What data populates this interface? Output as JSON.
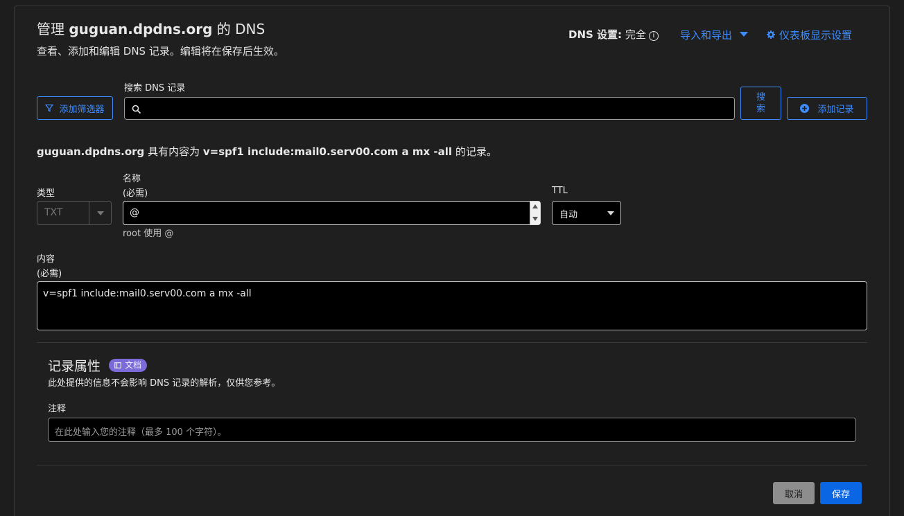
{
  "header": {
    "title_prefix": "管理 ",
    "title_domain": "guguan.dpdns.org",
    "title_suffix": " 的 DNS",
    "subtitle": "查看、添加和编辑 DNS 记录。编辑将在保存后生效。",
    "dns_setting_label": "DNS 设置:",
    "dns_setting_value": "完全",
    "import_export": "导入和导出",
    "dashboard_settings": "仪表板显示设置"
  },
  "search": {
    "label": "搜索 DNS 记录",
    "placeholder": "",
    "filter_button": "添加筛选器",
    "search_button": "搜\n索",
    "add_record_button": "添加记录"
  },
  "record_notice": {
    "domain": "guguan.dpdns.org",
    "middle": " 具有内容为 ",
    "content": "v=spf1 include:mail0.serv00.com a mx -all",
    "suffix": " 的记录。"
  },
  "form": {
    "type_label": "类型",
    "type_value": "TXT",
    "name_label": "名称",
    "name_required": "(必需)",
    "name_value": "@",
    "name_hint": "root 使用 @",
    "ttl_label": "TTL",
    "ttl_value": "自动",
    "content_label": "内容",
    "content_required": "(必需)",
    "content_value": "v=spf1 include:mail0.serv00.com a mx -all"
  },
  "attributes": {
    "title": "记录属性",
    "doc_badge": "文档",
    "description": "此处提供的信息不会影响 DNS 记录的解析，仅供您参考。",
    "comment_label": "注释",
    "comment_placeholder": "在此处输入您的注释（最多 100 个字符）。"
  },
  "actions": {
    "cancel": "取消",
    "save": "保存"
  },
  "colors": {
    "accent": "#3d8cff",
    "primary_button": "#0b66e4",
    "badge": "#7b6bd8"
  }
}
